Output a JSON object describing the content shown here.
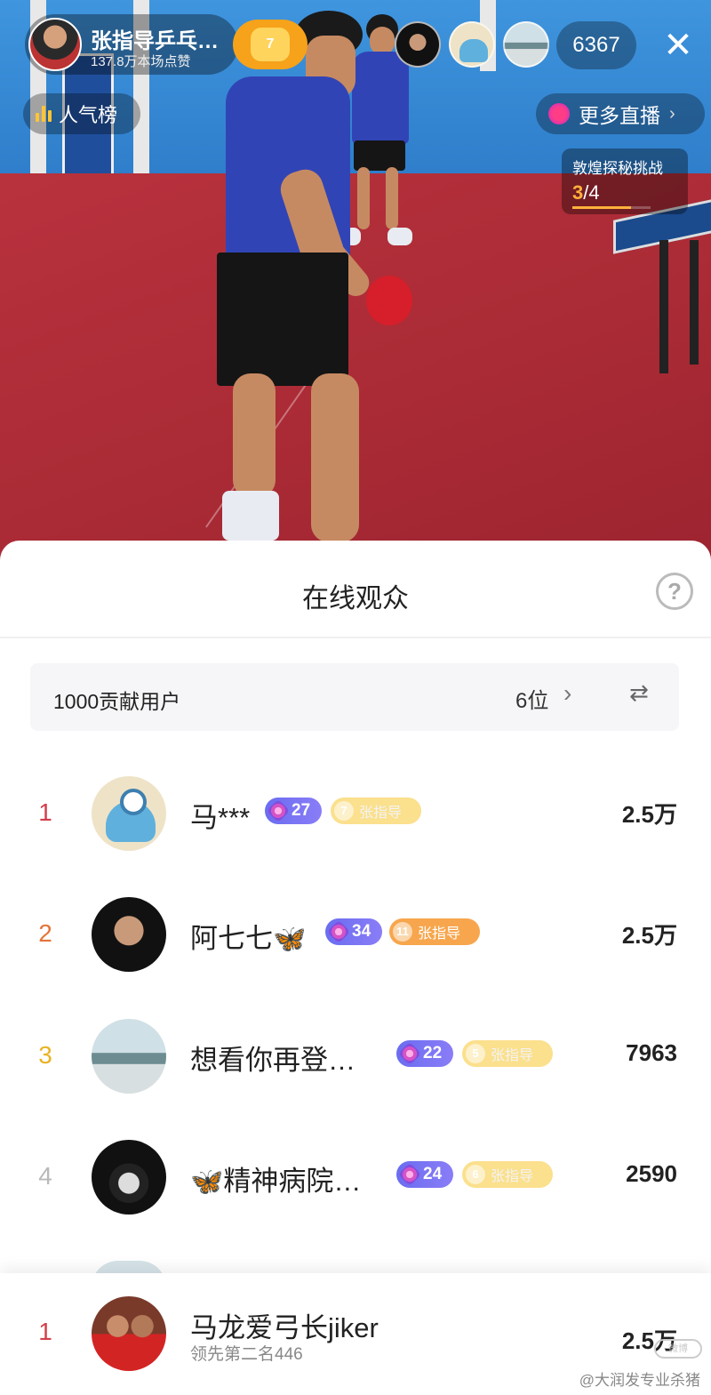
{
  "live": {
    "host_name": "张指导乒乓…",
    "host_likes": "137.8万本场点赞",
    "fan_level": "7",
    "viewer_count": "6367",
    "rank_label": "人气榜",
    "more_live_label": "更多直播",
    "challenge": {
      "title": "敦煌探秘挑战",
      "current": "3",
      "total": "/4",
      "progress": 0.75
    }
  },
  "sheet": {
    "title": "在线观众",
    "help_glyph": "?",
    "contributors": {
      "label": "1000贡献用户",
      "count": "6位",
      "chevron": "›",
      "swap_glyph": "⇄"
    },
    "rows": [
      {
        "rank": "1",
        "name": "马***",
        "level": "27",
        "club_level": "7",
        "club_name": "张指导",
        "amount": "2.5万",
        "rank_color": "#d2404c"
      },
      {
        "rank": "2",
        "name": "阿七七",
        "name_emoji": "🦋",
        "level": "34",
        "club_level": "11",
        "club_name": "张指导",
        "amount": "2.5万",
        "rank_color": "#e4743a"
      },
      {
        "rank": "3",
        "name": "想看你再登…",
        "level": "22",
        "club_level": "5",
        "club_name": "张指导",
        "amount": "7963",
        "rank_color": "#e8b325"
      },
      {
        "rank": "4",
        "name_emoji": "🦋",
        "name": "精神病院…",
        "level": "24",
        "club_level": "6",
        "club_name": "张指导",
        "amount": "2590",
        "rank_color": "#b9b9b9"
      }
    ]
  },
  "my_rank": {
    "rank": "1",
    "name": "马龙爱弓长jiker",
    "lead_text": "领先第二名446",
    "amount": "2.5万"
  },
  "watermark": "@大润发专业杀猪",
  "watermark_logo": "微博"
}
